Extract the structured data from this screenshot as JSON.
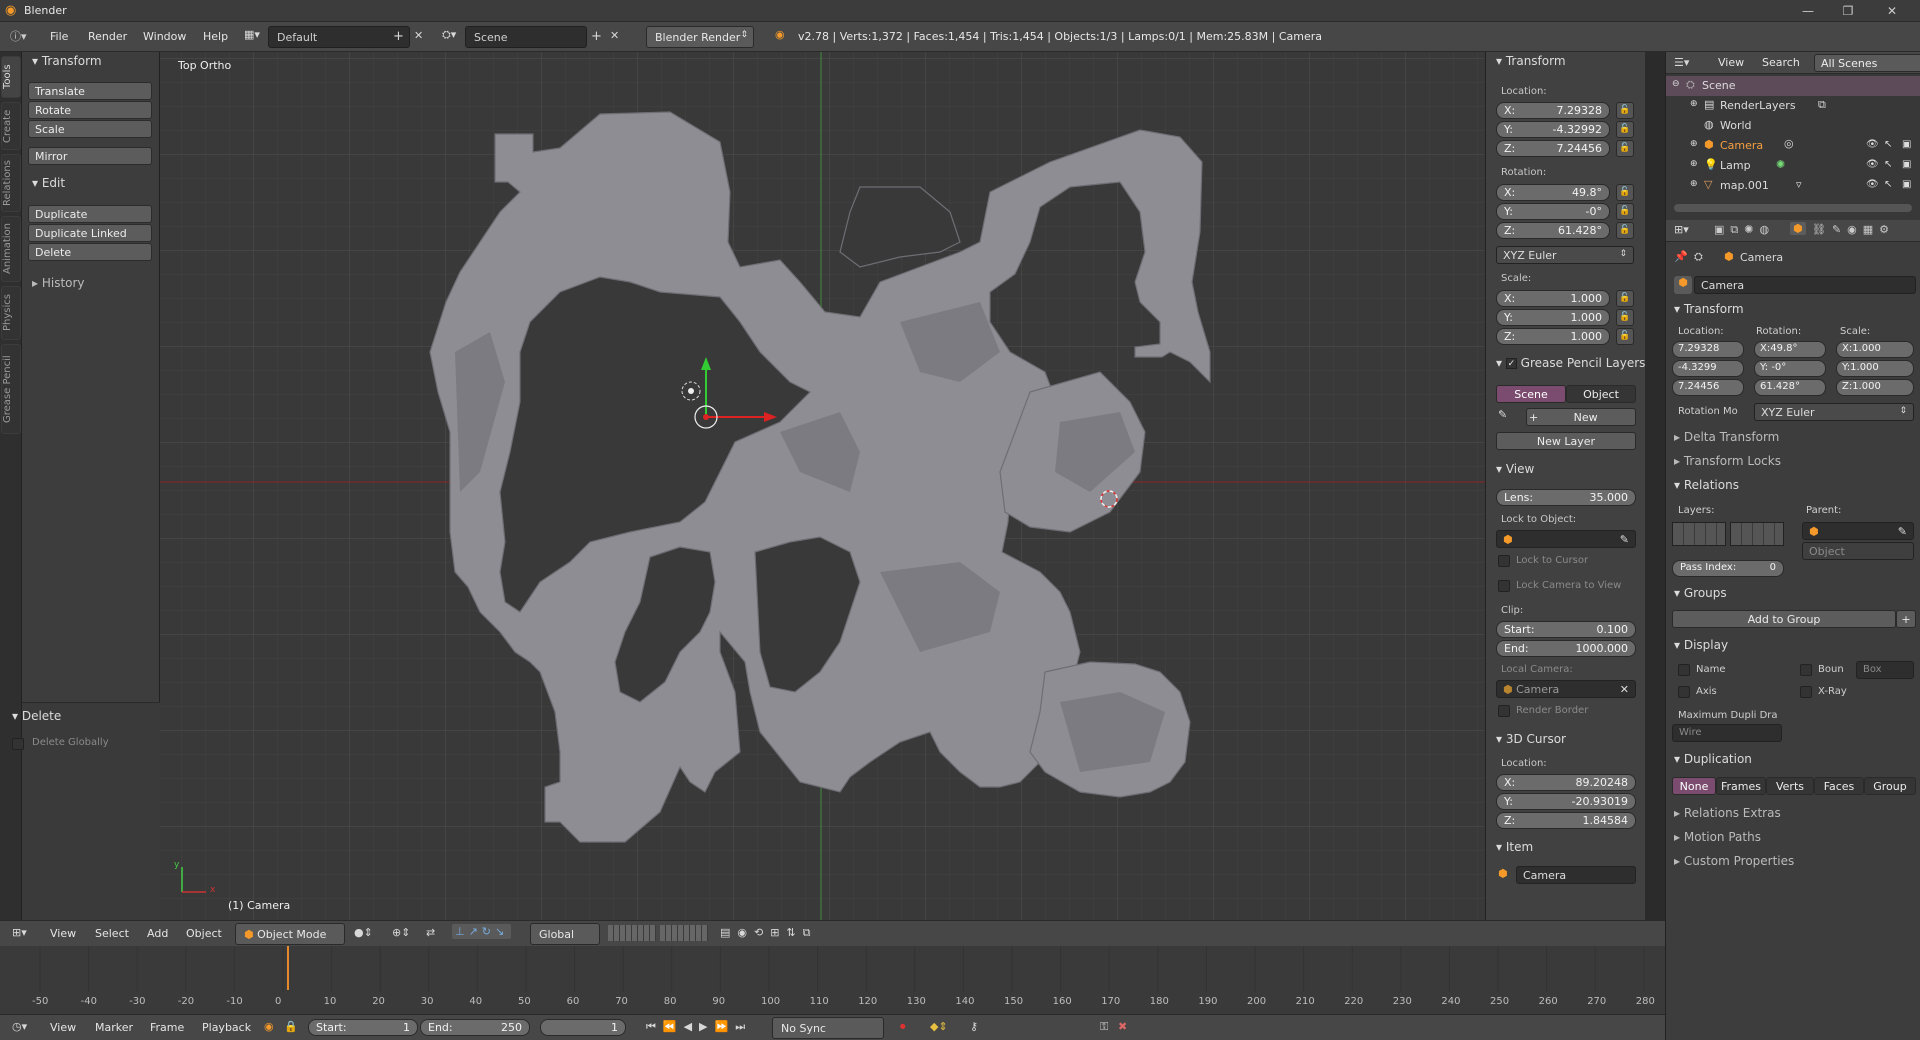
{
  "window": {
    "title": "Blender",
    "btn_min": "—",
    "btn_max": "❐",
    "btn_close": "✕"
  },
  "menu": {
    "file": "File",
    "render": "Render",
    "window": "Window",
    "help": "Help"
  },
  "screen_layout": "Default",
  "scene_name": "Scene",
  "render_engine": "Blender Render",
  "stats": "v2.78 | Verts:1,372 | Faces:1,454 | Tris:1,454 | Objects:1/3 | Lamps:0/1 | Mem:25.83M | Camera",
  "tool_tabs": [
    "Tools",
    "Create",
    "Relations",
    "Animation",
    "Physics",
    "Grease Pencil"
  ],
  "toolshelf": {
    "transform_title": "Transform",
    "transform_buttons": [
      "Translate",
      "Rotate",
      "Scale"
    ],
    "mirror": "Mirror",
    "edit_title": "Edit",
    "edit_buttons": [
      "Duplicate",
      "Duplicate Linked",
      "Delete"
    ],
    "history": "History",
    "operator_title": "Delete",
    "delete_globally": "Delete Globally"
  },
  "viewport": {
    "view_label": "Top Ortho",
    "object_label": "(1) Camera",
    "axis_x": "x",
    "axis_y": "y"
  },
  "npanel": {
    "transform_title": "Transform",
    "location_label": "Location:",
    "location": [
      {
        "k": "X:",
        "v": "7.29328"
      },
      {
        "k": "Y:",
        "v": "-4.32992"
      },
      {
        "k": "Z:",
        "v": "7.24456"
      }
    ],
    "rotation_label": "Rotation:",
    "rotation": [
      {
        "k": "X:",
        "v": "49.8°"
      },
      {
        "k": "Y:",
        "v": "-0°"
      },
      {
        "k": "Z:",
        "v": "61.428°"
      }
    ],
    "rotation_mode": "XYZ Euler",
    "scale_label": "Scale:",
    "scale": [
      {
        "k": "X:",
        "v": "1.000"
      },
      {
        "k": "Y:",
        "v": "1.000"
      },
      {
        "k": "Z:",
        "v": "1.000"
      }
    ],
    "gp_title": "Grease Pencil Layers",
    "gp_scene": "Scene",
    "gp_object": "Object",
    "gp_new": "New",
    "gp_new_layer": "New Layer",
    "view_title": "View",
    "lens_label": "Lens:",
    "lens_value": "35.000",
    "lock_to_object": "Lock to Object:",
    "lock_to_cursor": "Lock to Cursor",
    "lock_camera_to_view": "Lock Camera to View",
    "clip_label": "Clip:",
    "clip_start_label": "Start:",
    "clip_start": "0.100",
    "clip_end_label": "End:",
    "clip_end": "1000.000",
    "local_camera_label": "Local Camera:",
    "local_camera": "Camera",
    "render_border": "Render Border",
    "cursor_title": "3D Cursor",
    "cursor_location_label": "Location:",
    "cursor": [
      {
        "k": "X:",
        "v": "89.20248"
      },
      {
        "k": "Y:",
        "v": "-20.93019"
      },
      {
        "k": "Z:",
        "v": "1.84584"
      }
    ],
    "item_title": "Item",
    "item_name": "Camera"
  },
  "outliner": {
    "view": "View",
    "search": "Search",
    "filter": "All Scenes",
    "rows": [
      "Scene",
      "RenderLayers",
      "World",
      "Camera",
      "Lamp",
      "map.001"
    ]
  },
  "properties": {
    "object_name_path": "Camera",
    "object_field": "Camera",
    "transform_title": "Transform",
    "location_label": "Location:",
    "rotation_label": "Rotation:",
    "scale_label": "Scale:",
    "loc": [
      "7.29328",
      "-4.3299",
      "7.24456"
    ],
    "rot": [
      "X:49.8°",
      "Y: -0°",
      "61.428°"
    ],
    "scl": [
      "X:1.000",
      "Y:1.000",
      "Z:1.000"
    ],
    "rotation_mode_label": "Rotation Mo",
    "rotation_mode": "XYZ Euler",
    "delta_transform": "Delta Transform",
    "transform_locks": "Transform Locks",
    "relations_title": "Relations",
    "layers_label": "Layers:",
    "parent_label": "Parent:",
    "parent_type": "Object",
    "pass_index_label": "Pass Index:",
    "pass_index": "0",
    "groups_title": "Groups",
    "add_to_group": "Add to Group",
    "display_title": "Display",
    "name_opt": "Name",
    "bounds_opt": "Boun",
    "bounds_type": "Box",
    "axis_opt": "Axis",
    "xray_opt": "X-Ray",
    "max_dupli_label": "Maximum Dupli Dra",
    "max_dupli": "Wire",
    "duplication_title": "Duplication",
    "dup_tabs": [
      "None",
      "Frames",
      "Verts",
      "Faces",
      "Group"
    ],
    "relations_extras": "Relations Extras",
    "motion_paths": "Motion Paths",
    "custom_properties": "Custom Properties"
  },
  "view_header": {
    "view": "View",
    "select": "Select",
    "add": "Add",
    "object": "Object",
    "mode": "Object Mode",
    "orientation": "Global"
  },
  "timeline": {
    "ticks": [
      "-50",
      "-40",
      "-30",
      "-20",
      "-10",
      "0",
      "10",
      "20",
      "30",
      "40",
      "50",
      "60",
      "70",
      "80",
      "90",
      "100",
      "110",
      "120",
      "130",
      "140",
      "150",
      "160",
      "170",
      "180",
      "190",
      "200",
      "210",
      "220",
      "230",
      "240",
      "250",
      "260",
      "270",
      "280"
    ],
    "view": "View",
    "marker": "Marker",
    "frame": "Frame",
    "playback": "Playback",
    "start_label": "Start:",
    "start": "1",
    "end_label": "End:",
    "end": "250",
    "current": "1",
    "sync": "No Sync"
  },
  "colors": {
    "accent": "#7b4c6f",
    "x_axis": "#b33",
    "y_axis": "#4c4",
    "mesh": "#8d8d93",
    "frame_cursor": "#e8882e"
  }
}
